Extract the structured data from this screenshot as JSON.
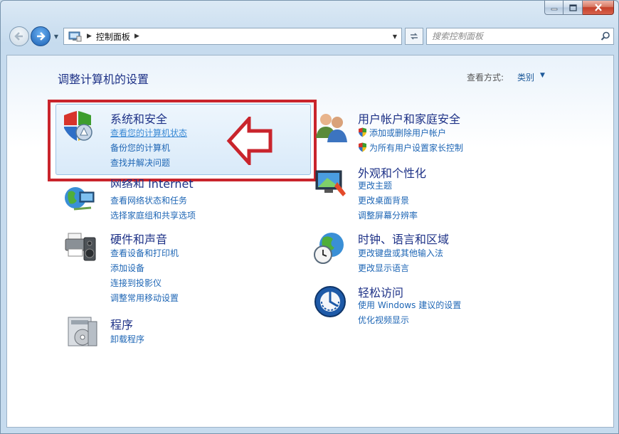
{
  "window": {
    "caption": {
      "min_icon": "minimize-icon",
      "max_icon": "maximize-icon",
      "close_icon": "close-icon"
    }
  },
  "nav": {
    "back_icon": "back-arrow-icon",
    "forward_icon": "forward-arrow-icon",
    "address": {
      "icon": "control-panel-icon",
      "path": "控制面板"
    },
    "search_placeholder": "搜索控制面板"
  },
  "main": {
    "title": "调整计算机的设置",
    "view_by_label": "查看方式:",
    "view_by_value": "类别",
    "categories": [
      {
        "title": "系统和安全",
        "icon": "shield-icon",
        "links": [
          "查看您的计算机状态",
          "备份您的计算机",
          "查找并解决问题"
        ]
      },
      {
        "title": "网络和 Internet",
        "icon": "network-globe-icon",
        "links": [
          "查看网络状态和任务",
          "选择家庭组和共享选项"
        ]
      },
      {
        "title": "硬件和声音",
        "icon": "printer-speaker-icon",
        "links": [
          "查看设备和打印机",
          "添加设备",
          "连接到投影仪",
          "调整常用移动设置"
        ]
      },
      {
        "title": "程序",
        "icon": "programs-icon",
        "links": [
          "卸载程序"
        ]
      },
      {
        "title": "用户帐户和家庭安全",
        "icon": "users-icon",
        "links": [
          "添加或删除用户帐户",
          "为所有用户设置家长控制"
        ]
      },
      {
        "title": "外观和个性化",
        "icon": "monitor-paint-icon",
        "links": [
          "更改主题",
          "更改桌面背景",
          "调整屏幕分辨率"
        ]
      },
      {
        "title": "时钟、语言和区域",
        "icon": "globe-clock-icon",
        "links": [
          "更改键盘或其他输入法",
          "更改显示语言"
        ]
      },
      {
        "title": "轻松访问",
        "icon": "ease-of-access-icon",
        "links": [
          "使用 Windows 建议的设置",
          "优化视频显示"
        ]
      }
    ]
  },
  "colors": {
    "title_blue": "#1e3287",
    "link_blue": "#1e66b5",
    "highlight_red": "#c9242c"
  }
}
